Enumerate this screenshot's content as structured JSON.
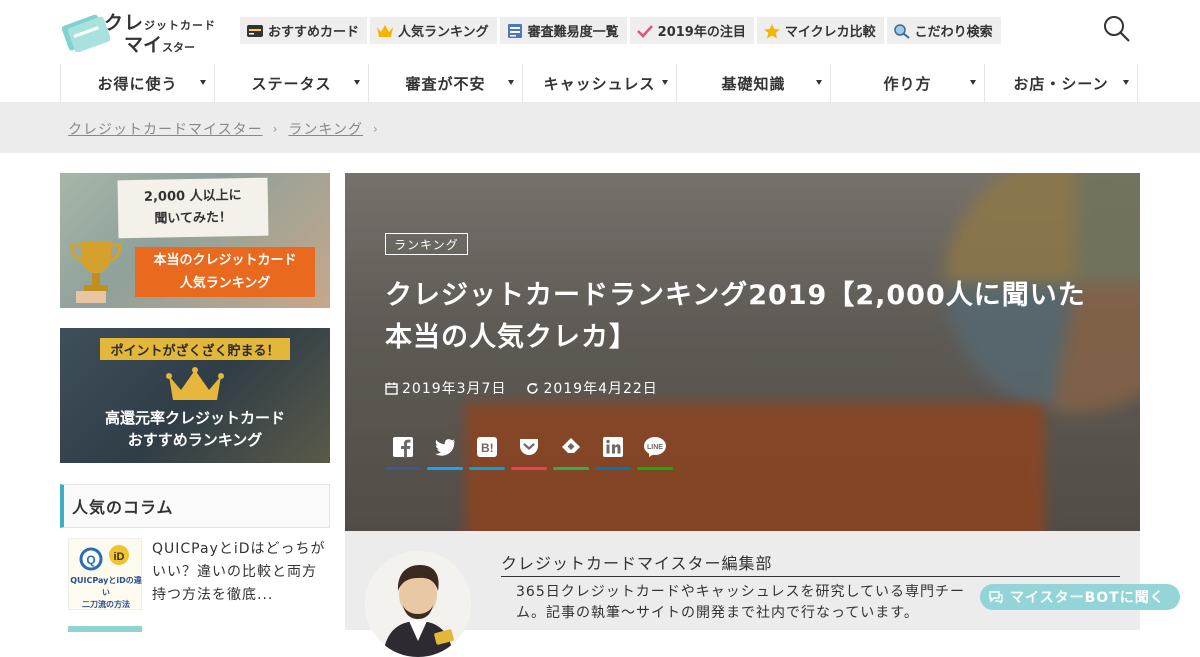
{
  "logo": {
    "line1_big": "クレ",
    "line1_small": "ジットカード",
    "line2_big": "マイ",
    "line2_small": "スター"
  },
  "toplinks": [
    {
      "label": "おすすめカード",
      "icon": "credit-card-icon"
    },
    {
      "label": "人気ランキング",
      "icon": "crown-icon"
    },
    {
      "label": "審査難易度一覧",
      "icon": "clipboard-icon"
    },
    {
      "label": "2019年の注目",
      "icon": "check-icon"
    },
    {
      "label": "マイクレカ比較",
      "icon": "star-icon"
    },
    {
      "label": "こだわり検索",
      "icon": "magnifier-icon"
    }
  ],
  "nav": [
    {
      "label": "お得に使う"
    },
    {
      "label": "ステータス"
    },
    {
      "label": "審査が不安"
    },
    {
      "label": "キャッシュレス"
    },
    {
      "label": "基礎知識"
    },
    {
      "label": "作り方"
    },
    {
      "label": "お店・シーン"
    }
  ],
  "breadcrumb": [
    {
      "label": "クレジットカードマイスター"
    },
    {
      "label": "ランキング"
    }
  ],
  "banners": {
    "b1_note_1": "2,000 人以上に",
    "b1_note_2": "聞いてみた！",
    "b1_orange_1": "本当のクレジットカード",
    "b1_orange_2": "人気ランキング",
    "b2_top": "ポイントがざくざく貯まる！",
    "b2_line1": "高還元率クレジットカード",
    "b2_line2": "おすすめランキング"
  },
  "column": {
    "heading": "人気のコラム",
    "item1_text": "QUICPayとiDはどっちがいい？違いの比較と両方持つ方法を徹底...",
    "item1_thumb_1": "QUICPayとiDの違い",
    "item1_thumb_2": "二刀流の方法"
  },
  "hero": {
    "category": "ランキング",
    "title": "クレジットカードランキング2019【2,000人に聞いた本当の人気クレカ】",
    "published": "2019年3月7日",
    "updated": "2019年4月22日",
    "shares": [
      {
        "name": "facebook-share",
        "icon": "facebook-icon",
        "color": "#3b5998"
      },
      {
        "name": "twitter-share",
        "icon": "twitter-icon",
        "color": "#1da1f2"
      },
      {
        "name": "hatena-share",
        "icon": "hatena-bookmark-icon",
        "color": "#00a4de"
      },
      {
        "name": "pocket-share",
        "icon": "pocket-icon",
        "color": "#ef4056"
      },
      {
        "name": "feedly-share",
        "icon": "feedly-icon",
        "color": "#2bb24c"
      },
      {
        "name": "linkedin-share",
        "icon": "linkedin-icon",
        "color": "#0077b5"
      },
      {
        "name": "line-share",
        "icon": "line-icon",
        "color": "#00b900"
      }
    ]
  },
  "author": {
    "name": "クレジットカードマイスター編集部",
    "desc": "365日クレジットカードやキャッシュレスを研究している専門チーム。記事の執筆～サイトの開発まで社内で行なっています。"
  },
  "bot": {
    "label": "マイスターBOTに聞く"
  }
}
